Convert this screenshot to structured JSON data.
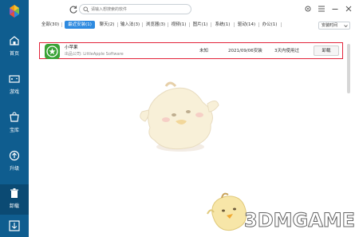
{
  "sidebar": {
    "items": [
      {
        "label": "首页",
        "icon": "home-icon"
      },
      {
        "label": "游戏",
        "icon": "gamepad-icon"
      },
      {
        "label": "宝库",
        "icon": "store-icon"
      },
      {
        "label": "升级",
        "icon": "upgrade-icon"
      },
      {
        "label": "卸载",
        "icon": "trash-icon"
      }
    ],
    "active": "卸载"
  },
  "search": {
    "placeholder": "请输入想搜索的软件"
  },
  "tabs": [
    {
      "label": "全部(30)"
    },
    {
      "label": "最近安装(1)"
    },
    {
      "label": "聊天(2)"
    },
    {
      "label": "输入法(3)"
    },
    {
      "label": "浏览器(3)"
    },
    {
      "label": "视频(1)"
    },
    {
      "label": "图片(1)"
    },
    {
      "label": "系统(1)"
    },
    {
      "label": "驱动(14)"
    },
    {
      "label": "办公(1)"
    }
  ],
  "active_tab": "最近安装(1)",
  "sort": {
    "label": "安装时间"
  },
  "apps": [
    {
      "name": "小苹果",
      "publisher": "出品公司: LittleApple Software",
      "size": "未知",
      "install_date": "2021/09/06安装",
      "last_used": "3天内使用过",
      "action": "卸载"
    }
  ],
  "watermark": "3DMGAME",
  "colors": {
    "sidebar": "#0f5d8f",
    "accent": "#2d8ae0",
    "highlight": "#e3243b"
  }
}
